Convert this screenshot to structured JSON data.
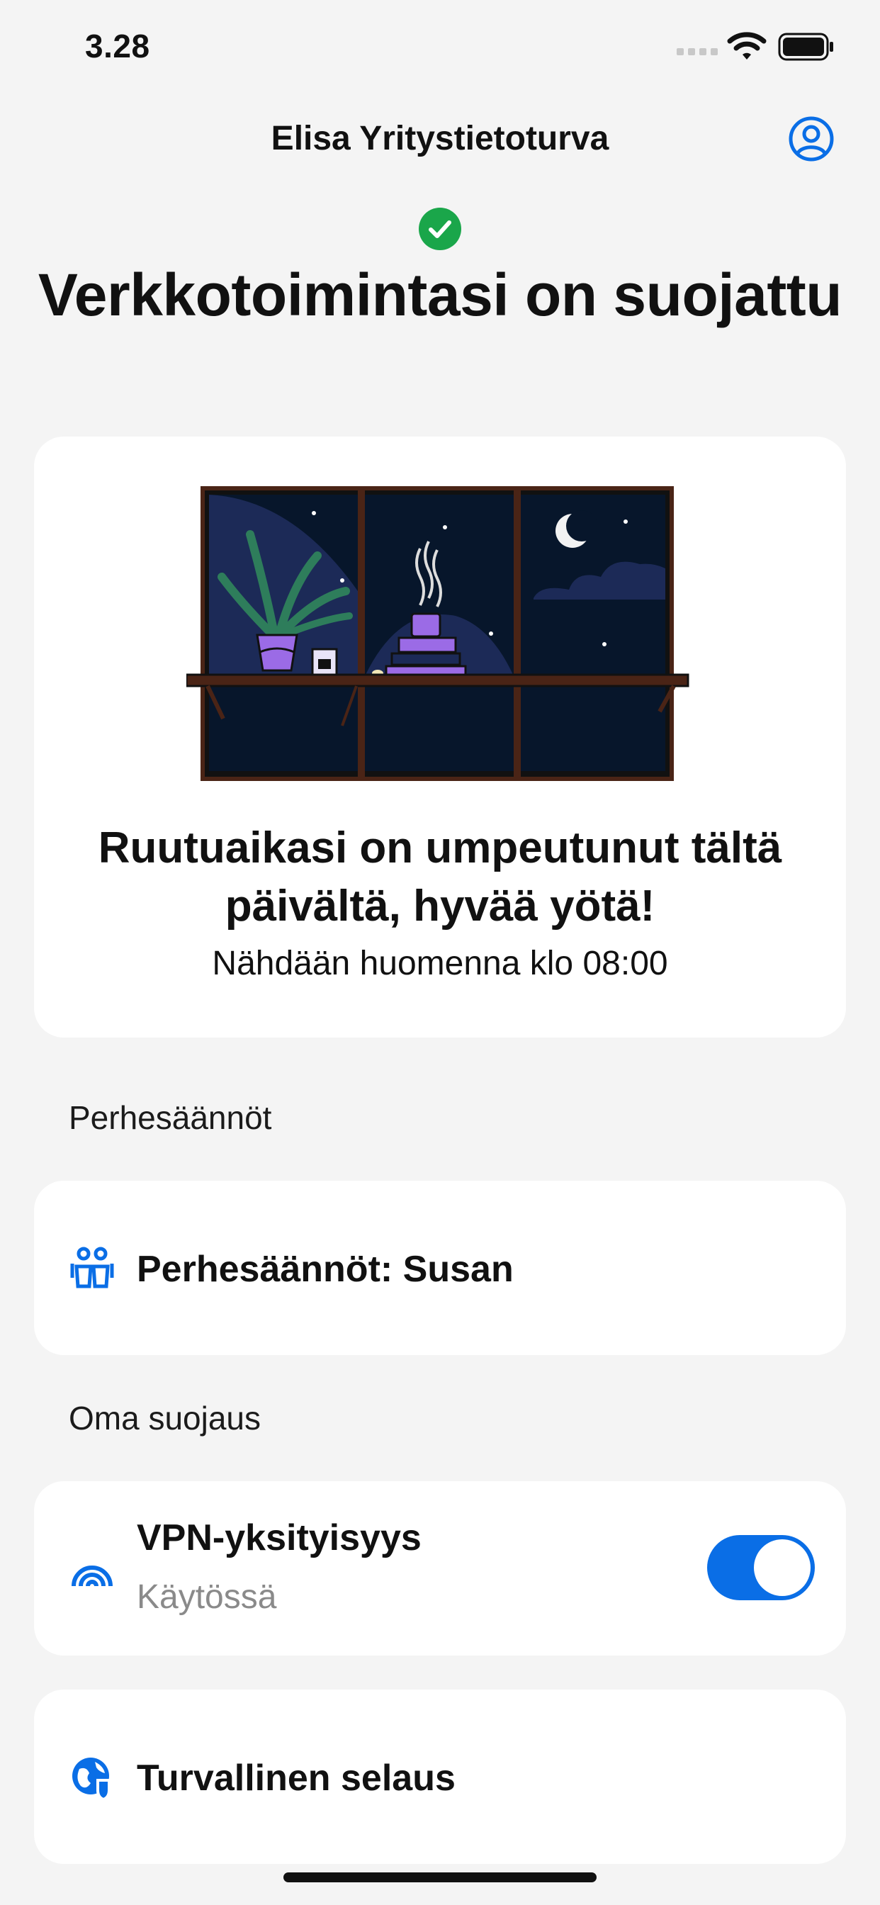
{
  "status_bar": {
    "time": "3.28"
  },
  "nav": {
    "title": "Elisa Yritystietoturva"
  },
  "header": {
    "title": "Verkkotoimintasi on suojattu"
  },
  "screen_time_card": {
    "title": "Ruutuaikasi on umpeutunut tältä päivältä, hyvää yötä!",
    "subtitle": "Nähdään huomenna klo 08:00"
  },
  "sections": {
    "family_rules": "Perhesäännöt",
    "own_protection": "Oma suojaus"
  },
  "family_rules_item": {
    "label": "Perhesäännöt: Susan"
  },
  "vpn_item": {
    "label": "VPN-yksityisyys",
    "status": "Käytössä",
    "enabled": true
  },
  "safe_browsing_item": {
    "label": "Turvallinen selaus"
  },
  "colors": {
    "accent": "#0a6ee6",
    "success": "#1aa64a",
    "background": "#f4f4f4"
  },
  "icons": [
    "signal-icon",
    "wifi-icon",
    "battery-icon",
    "profile-icon",
    "check-icon",
    "family-icon",
    "vpn-icon",
    "globe-shield-icon"
  ]
}
